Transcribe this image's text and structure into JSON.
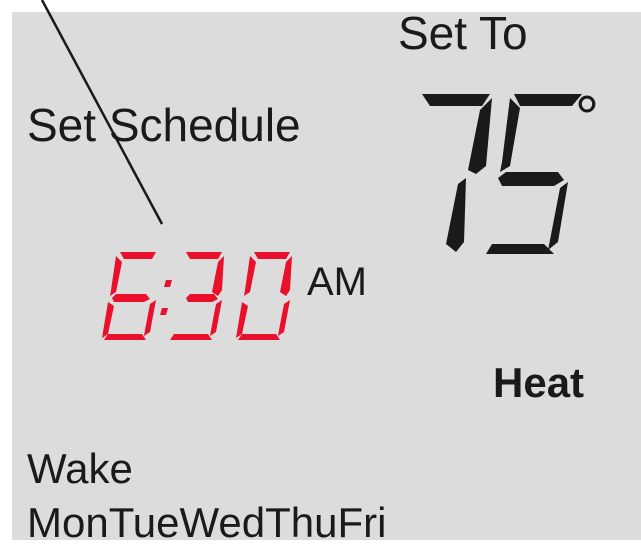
{
  "display": {
    "set_to_label": "Set To",
    "setpoint_value": "75",
    "degree_symbol": "°",
    "schedule_label": "Set Schedule",
    "schedule_time": "6:30",
    "ampm": "AM",
    "mode": "Heat",
    "period": "Wake",
    "days": "MonTueWedThuFri"
  },
  "colors": {
    "screen_background": "#dcdcdc",
    "text": "#1a1a1a",
    "time_digits": "#e8102a"
  }
}
